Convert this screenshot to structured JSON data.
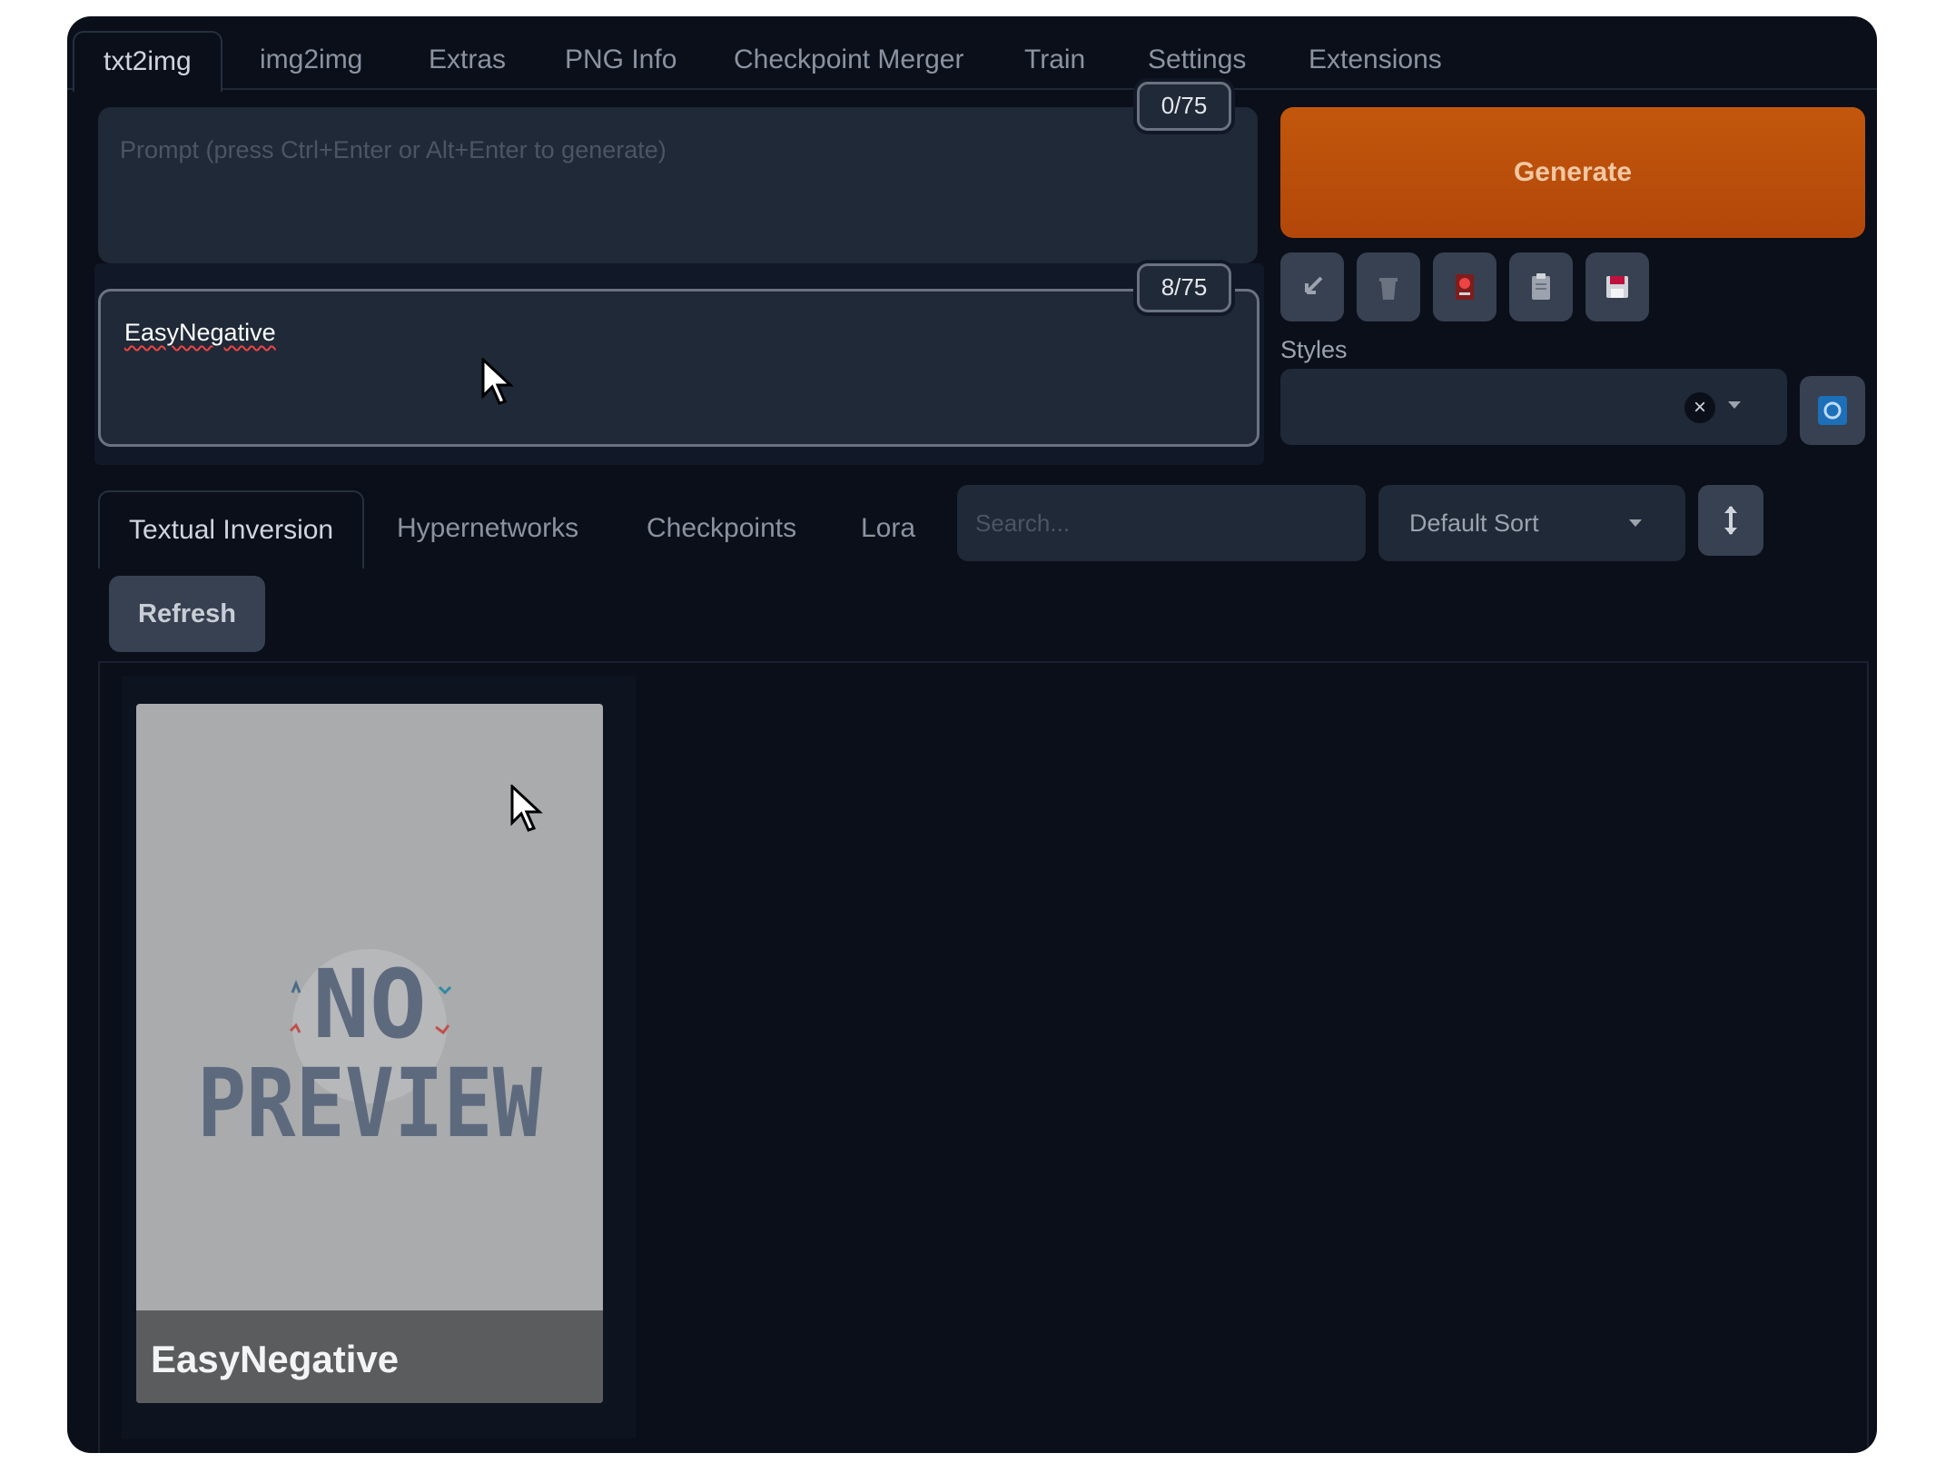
{
  "top_tabs": [
    "txt2img",
    "img2img",
    "Extras",
    "PNG Info",
    "Checkpoint Merger",
    "Train",
    "Settings",
    "Extensions"
  ],
  "prompt": {
    "placeholder": "Prompt (press Ctrl+Enter or Alt+Enter to generate)",
    "counter": "0/75"
  },
  "negative_prompt": {
    "value": "EasyNegative",
    "counter": "8/75"
  },
  "generate_label": "Generate",
  "tool_buttons": [
    "arrow-icon",
    "trash-icon",
    "red-card-icon",
    "clipboard-icon",
    "save-icon"
  ],
  "styles": {
    "label": "Styles"
  },
  "network_tabs": [
    "Textual Inversion",
    "Hypernetworks",
    "Checkpoints",
    "Lora"
  ],
  "search": {
    "placeholder": "Search..."
  },
  "sort": {
    "label": "Default Sort"
  },
  "refresh_label": "Refresh",
  "card": {
    "image_text_line1": "NO",
    "image_text_line2": "PREVIEW",
    "name": "EasyNegative"
  },
  "colors": {
    "background": "#0b0f19",
    "panel": "#1f2937",
    "accent": "#c2570c"
  }
}
